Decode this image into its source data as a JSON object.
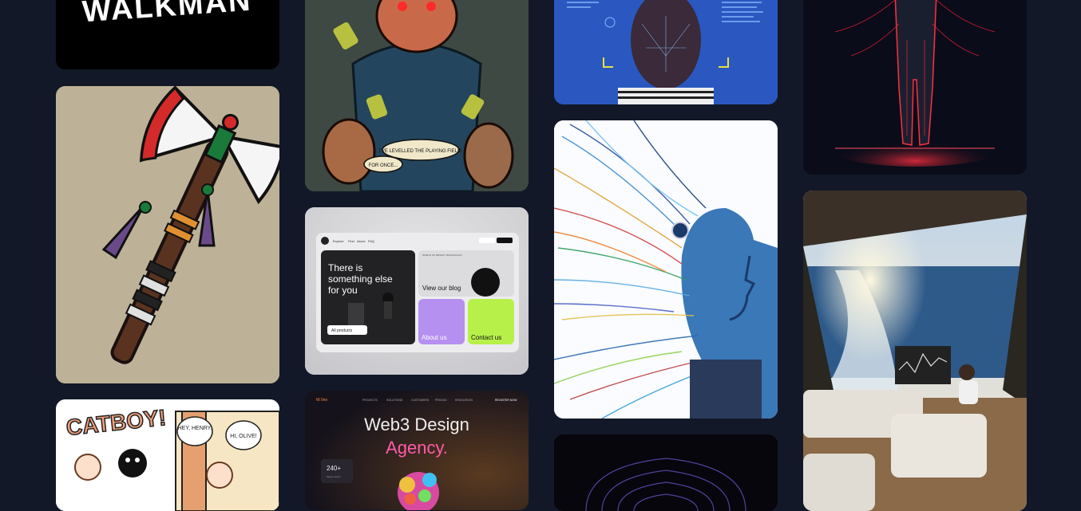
{
  "gallery": {
    "col1": {
      "walkman": {
        "text": "WALKMAN",
        "alt": "walkman-artwork"
      },
      "axe": {
        "alt": "tattoo-axe-artwork"
      },
      "catboy": {
        "title": "CATBOY!",
        "bubble1": "HEY, HENRY.",
        "bubble2": "HI, OLIVE!"
      }
    },
    "col2": {
      "comic": {
        "caption1": "I'VE LEVELLED THE PLAYING FIELD!",
        "caption2": "FOR ONCE..."
      },
      "ui_mock": {
        "nav": [
          "Explore",
          "Find",
          "About",
          "FAQ"
        ],
        "headline": "There is something else for you",
        "products_btn": "All products",
        "blog_card_tag": "WORLD OF DESIGN TECHNOLOGY",
        "blog": "View our blog",
        "about": "About us",
        "contact": "Contact us"
      },
      "web3": {
        "logo": "W.Vex",
        "nav": [
          "PROJECTS",
          "SOLUTIONS",
          "CUSTOMERS",
          "PRICING",
          "RESOURCES"
        ],
        "cta": "REGISTER NOW",
        "title_line1": "Web3 Design",
        "title_line2": "Agency.",
        "stat": "240+",
        "stat_label": "happy clients"
      }
    },
    "col3": {
      "face_scan": {
        "alt": "face-scan-artwork"
      },
      "wires": {
        "alt": "wire-head-artwork"
      },
      "circuit": {
        "alt": "circuit-brain-artwork"
      }
    },
    "col4": {
      "red_figure": {
        "alt": "red-nerve-figure"
      },
      "yacht": {
        "alt": "yacht-trading-artwork"
      }
    }
  },
  "colors": {
    "background": "#121827",
    "purple": "#b690f0",
    "lime": "#b8f04a",
    "pink": "#ff5ca8"
  }
}
